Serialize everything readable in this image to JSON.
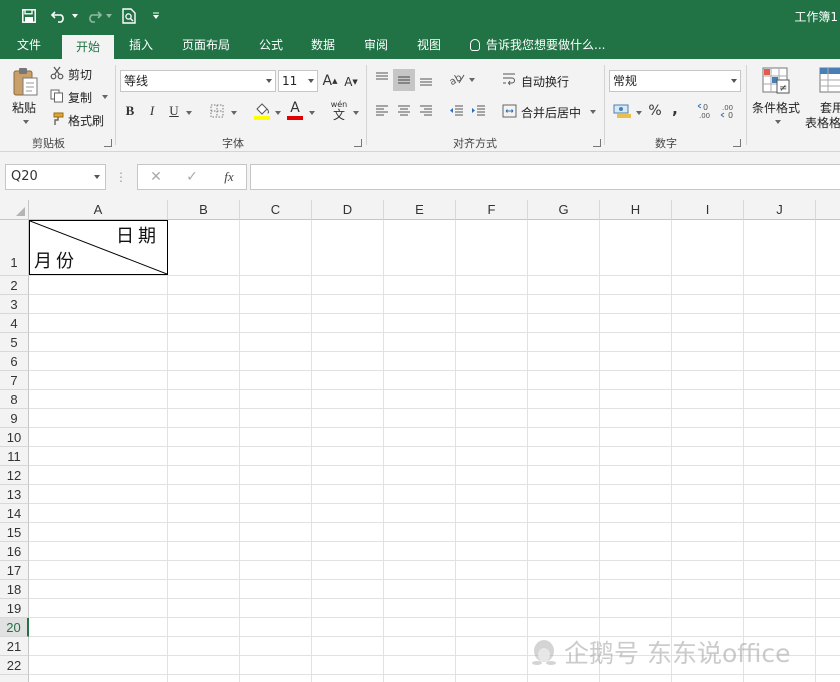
{
  "window": {
    "title": "工作簿1"
  },
  "quick_access": {
    "icons": [
      "save-icon",
      "undo-icon",
      "redo-icon",
      "print-preview-icon",
      "customize-icon"
    ]
  },
  "tabs": [
    {
      "label": "文件",
      "active": false
    },
    {
      "label": "开始",
      "active": true
    },
    {
      "label": "插入",
      "active": false
    },
    {
      "label": "页面布局",
      "active": false
    },
    {
      "label": "公式",
      "active": false
    },
    {
      "label": "数据",
      "active": false
    },
    {
      "label": "审阅",
      "active": false
    },
    {
      "label": "视图",
      "active": false
    }
  ],
  "tell_me": "告诉我您想要做什么...",
  "ribbon": {
    "clipboard": {
      "paste_label": "粘贴",
      "cut_label": "剪切",
      "copy_label": "复制",
      "format_painter_label": "格式刷",
      "group_label": "剪贴板"
    },
    "font": {
      "font_name": "等线",
      "font_size": "11",
      "bold": "B",
      "italic": "I",
      "underline": "U",
      "font_color_glyph": "A",
      "grow_glyph": "A",
      "shrink_glyph": "A",
      "phonetic_glyph": "wén",
      "group_label": "字体"
    },
    "alignment": {
      "wrap_text_label": "自动换行",
      "merge_center_label": "合并后居中",
      "group_label": "对齐方式"
    },
    "number": {
      "format": "常规",
      "percent_glyph": "%",
      "comma_glyph": ",",
      "group_label": "数字"
    },
    "styles": {
      "conditional_format_label": "条件格式",
      "table_format_label_line1": "套用",
      "table_format_label_line2": "表格格式"
    }
  },
  "formula_bar": {
    "name_box": "Q20",
    "cancel_glyph": "✕",
    "enter_glyph": "✓",
    "fx_glyph": "fx",
    "formula": ""
  },
  "sheet": {
    "columns": [
      "A",
      "B",
      "C",
      "D",
      "E",
      "F",
      "G",
      "H",
      "I",
      "J"
    ],
    "rows": [
      "1",
      "2",
      "3",
      "4",
      "5",
      "6",
      "7",
      "8",
      "9",
      "10",
      "11",
      "12",
      "13",
      "14",
      "15",
      "16",
      "17",
      "18",
      "19",
      "20",
      "21",
      "22"
    ],
    "selected_row": "20",
    "a1_top_text": "日期",
    "a1_bottom_text": "月份"
  },
  "watermark": {
    "text": "企鹅号 东东说office"
  }
}
